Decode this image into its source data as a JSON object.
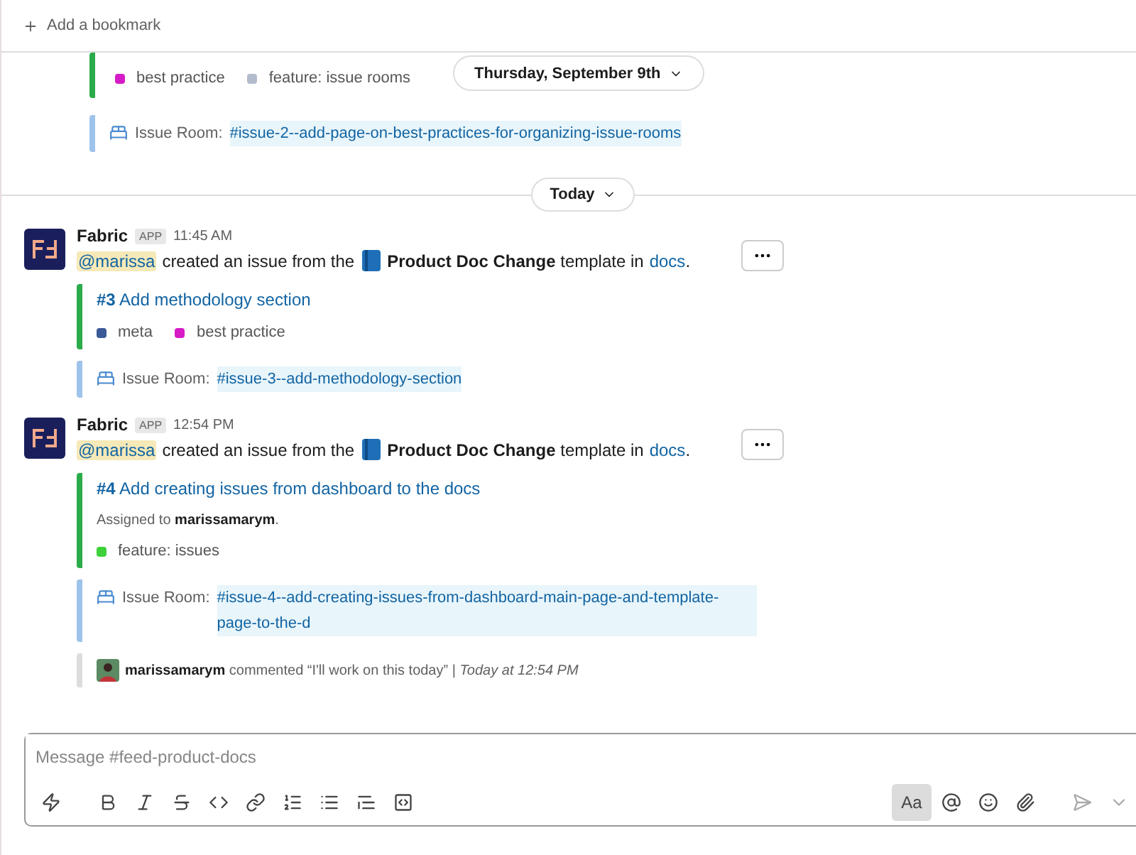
{
  "bookmark_bar": {
    "add_label": "Add a bookmark"
  },
  "date_pill": {
    "label": "Thursday, September 9th"
  },
  "earlier": {
    "labels": [
      {
        "name": "best practice",
        "color": "#d61bc7"
      },
      {
        "name": "feature: issue rooms",
        "color": "#b3bccd"
      }
    ],
    "issue_room": {
      "prefix": "Issue Room:",
      "link": "#issue-2--add-page-on-best-practices-for-organizing-issue-rooms"
    }
  },
  "divider": {
    "label": "Today"
  },
  "messages": [
    {
      "sender": "Fabric",
      "badge": "APP",
      "time": "11:45 AM",
      "mention": "@marissa",
      "text_before": "created an issue from the",
      "template": "**Product Doc Change** template in",
      "channel_link": "docs",
      "text_after": ".",
      "issue": {
        "title": "**#3** Add methodology section",
        "labels": [
          {
            "name": "meta",
            "color": "#3d5a98"
          },
          {
            "name": "best practice",
            "color": "#d61bc7"
          }
        ]
      },
      "issue_room": {
        "prefix": "Issue Room:",
        "link": "#issue-3--add-methodology-section"
      }
    },
    {
      "sender": "Fabric",
      "badge": "APP",
      "time": "12:54 PM",
      "mention": "@marissa",
      "text_before": "created an issue from the",
      "template": "**Product Doc Change** template in",
      "channel_link": "docs",
      "text_after": ".",
      "issue": {
        "title": "**#4** Add creating issues from dashboard to the docs",
        "assignment": "Assigned to **marissamarym**.",
        "labels": [
          {
            "name": "feature: issues",
            "color": "#3ed13a"
          }
        ]
      },
      "issue_room": {
        "prefix": "Issue Room:",
        "link": "#issue-4--add-creating-issues-from-dashboard-main-page-and-template-page-to-the-d"
      },
      "comment": "**marissamarym** commented “I'll work on this today” | *Today at 12:54 PM*"
    }
  ],
  "composer": {
    "placeholder": "Message #feed-product-docs",
    "tools": [
      {
        "kind": "shortcuts",
        "selected": false
      },
      {
        "kind": "bold",
        "selected": false
      },
      {
        "kind": "italic",
        "selected": false
      },
      {
        "kind": "strike",
        "selected": false
      },
      {
        "kind": "code",
        "selected": false
      },
      {
        "kind": "link",
        "selected": false
      },
      {
        "kind": "ordered",
        "selected": false
      },
      {
        "kind": "bullet",
        "selected": false
      },
      {
        "kind": "quote",
        "selected": false
      },
      {
        "kind": "codeblock",
        "selected": false
      },
      {
        "kind": "format",
        "label": "Aa",
        "selected": true
      },
      {
        "kind": "mention",
        "selected": false
      },
      {
        "kind": "emoji",
        "selected": false
      },
      {
        "kind": "attach",
        "selected": false
      },
      {
        "kind": "send",
        "selected": false
      },
      {
        "kind": "send-options",
        "selected": false
      }
    ]
  }
}
